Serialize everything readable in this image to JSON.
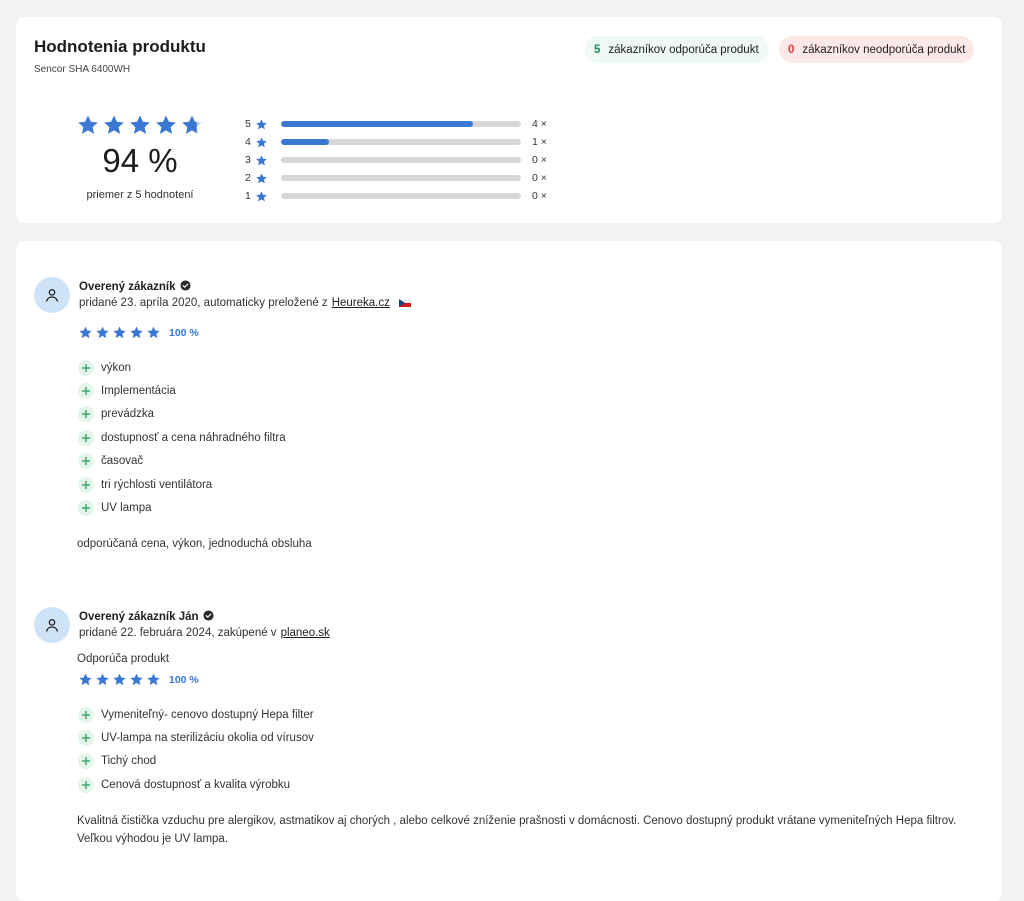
{
  "summary": {
    "title": "Hodnotenia produktu",
    "product": "Sencor SHA 6400WH",
    "recommend_count": "5",
    "recommend_label": "zákazníkov odporúča produkt",
    "not_recommend_count": "0",
    "not_recommend_label": "zákazníkov neodporúča produkt",
    "percent": "94 %",
    "stars_value": 4.7,
    "average_text": "priemer z 5 hodnotení",
    "distribution": [
      {
        "stars": "5",
        "count": "4 ×",
        "fraction": 0.8
      },
      {
        "stars": "4",
        "count": "1 ×",
        "fraction": 0.2
      },
      {
        "stars": "3",
        "count": "0 ×",
        "fraction": 0
      },
      {
        "stars": "2",
        "count": "0 ×",
        "fraction": 0
      },
      {
        "stars": "1",
        "count": "0 ×",
        "fraction": 0
      }
    ]
  },
  "reviews": [
    {
      "author": "Overený zákazník",
      "date_text": "pridané 23. apríla 2020, automaticky preložené z",
      "source_link": "Heureka.cz",
      "rating_percent": "100 %",
      "pros": [
        "výkon",
        "Implementácia",
        "prevádzka",
        "dostupnosť a cena náhradného filtra",
        "časovač",
        "tri rýchlosti ventilátora",
        "UV lampa"
      ],
      "text": "odporúčaná cena, výkon, jednoduchá obsluha"
    },
    {
      "author": "Overený zákazník Ján",
      "date_text": "pridané 22. februára 2024, zakúpené v",
      "source_link": "planeo.sk",
      "recommend_text": "Odporúča produkt",
      "rating_percent": "100 %",
      "pros": [
        "Vymeniteľný- cenovo dostupný Hepa filter",
        "UV-lampa na sterilizáciu okolia od vírusov",
        "Tichý chod",
        "Cenová dostupnosť a kvalita výrobku"
      ],
      "text": "Kvalitná čistička vzduchu pre alergikov, astmatikov aj chorých , alebo celkové zníženie prašnosti v domácnosti. Cenovo dostupný produkt vrátane vymeniteľných Hepa filtrov. Veľkou výhodou je UV lampa."
    }
  ],
  "colors": {
    "star": "#3a78d4",
    "star_empty": "#c9d6e8",
    "positive": "#1e8a5a",
    "negative": "#d93a3a",
    "plus_icon": "#3aa66a"
  },
  "icons": {
    "star": "star-icon",
    "verified": "verified-check-icon",
    "avatar": "user-icon",
    "plus": "plus-icon",
    "flag": "czech-flag-icon"
  }
}
